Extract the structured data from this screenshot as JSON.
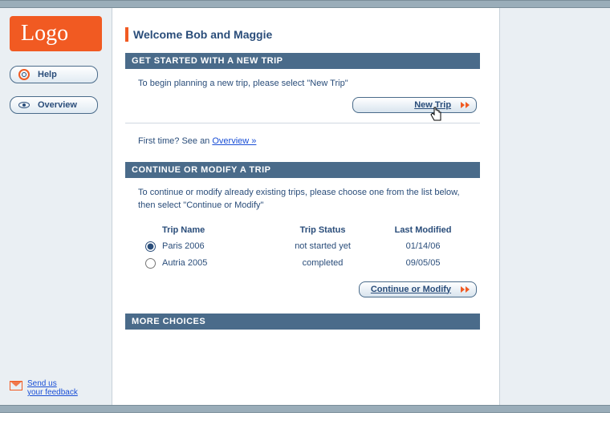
{
  "logo": "Logo",
  "sidebar": {
    "help": "Help",
    "overview": "Overview",
    "feedback_line1": "Send us",
    "feedback_line2": "your feedback"
  },
  "welcome": "Welcome Bob and Maggie",
  "section_new": {
    "header": "GET STARTED WITH A NEW TRIP",
    "text": "To begin planning a new trip, please select \"New Trip\"",
    "button": "New Trip",
    "hint_prefix": "First time? See an ",
    "hint_link": "Overview »"
  },
  "section_continue": {
    "header": "CONTINUE OR MODIFY A TRIP",
    "text": "To continue or modify already existing trips, please choose one from the list below, then select \"Continue or Modify\"",
    "columns": {
      "name": "Trip Name",
      "status": "Trip Status",
      "modified": "Last Modified"
    },
    "rows": [
      {
        "selected": true,
        "name": "Paris 2006",
        "status": "not started yet",
        "modified": "01/14/06"
      },
      {
        "selected": false,
        "name": "Autria 2005",
        "status": "completed",
        "modified": "09/05/05"
      }
    ],
    "button": "Continue or Modify"
  },
  "section_more": {
    "header": "MORE CHOICES"
  }
}
